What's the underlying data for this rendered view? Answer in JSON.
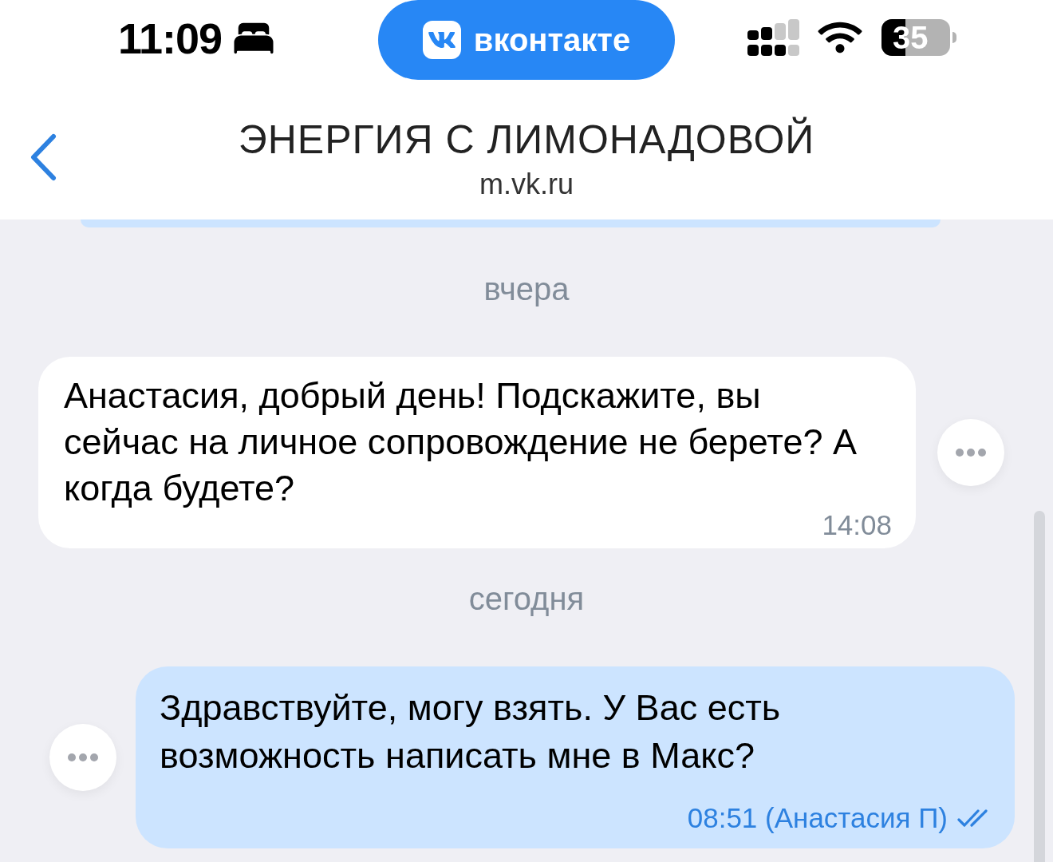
{
  "status_bar": {
    "time": "11:09",
    "app_pill": {
      "label": "вконтакте"
    },
    "battery": "35"
  },
  "header": {
    "title": "ЭНЕРГИЯ С ЛИМОНАДОВОЙ",
    "subtitle": "m.vk.ru"
  },
  "feed": [
    {
      "kind": "date",
      "text": "вчера"
    },
    {
      "kind": "incoming",
      "text": "Анастасия, добрый день! Подскажите, вы сейчас на личное сопровождение не берете? А когда будете?",
      "time": "14:08"
    },
    {
      "kind": "date",
      "text": "сегодня"
    },
    {
      "kind": "outgoing",
      "text": "Здравствуйте, могу взять. У Вас есть возможность написать мне в Макс?",
      "time": "08:51 (Анастасия П)",
      "read": true
    }
  ]
}
